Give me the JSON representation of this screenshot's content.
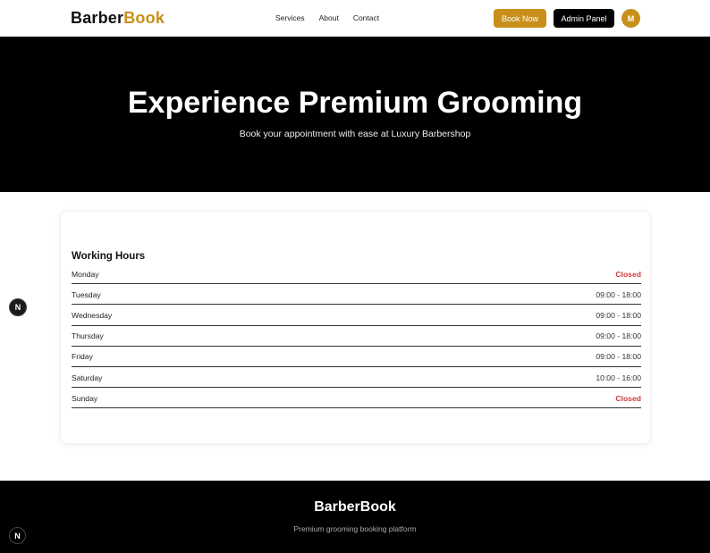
{
  "header": {
    "logo_part1": "Barber",
    "logo_part2": "Book",
    "nav": [
      {
        "label": "Services"
      },
      {
        "label": "About"
      },
      {
        "label": "Contact"
      }
    ],
    "book_now_label": "Book Now",
    "admin_label": "Admin Panel",
    "avatar_initial": "M"
  },
  "hero": {
    "title": "Experience Premium Grooming",
    "subtitle": "Book your appointment with ease at Luxury Barbershop"
  },
  "working_hours": {
    "title": "Working Hours",
    "days": [
      {
        "day": "Monday",
        "hours": "Closed",
        "closed": true
      },
      {
        "day": "Tuesday",
        "hours": "09:00 - 18:00",
        "closed": false
      },
      {
        "day": "Wednesday",
        "hours": "09:00 - 18:00",
        "closed": false
      },
      {
        "day": "Thursday",
        "hours": "09:00 - 18:00",
        "closed": false
      },
      {
        "day": "Friday",
        "hours": "09:00 - 18:00",
        "closed": false
      },
      {
        "day": "Saturday",
        "hours": "10:00 - 16:00",
        "closed": false
      },
      {
        "day": "Sunday",
        "hours": "Closed",
        "closed": true
      }
    ]
  },
  "footer": {
    "title": "BarberBook",
    "tagline": "Premium grooming booking platform"
  },
  "badges": {
    "letter": "N"
  },
  "colors": {
    "accent": "#c8901a",
    "closed": "#d43a3a",
    "dark": "#000000"
  }
}
